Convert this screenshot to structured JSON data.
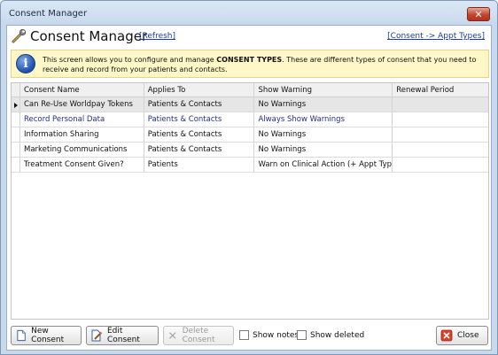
{
  "window": {
    "title": "Consent Manager",
    "close_glyph": "✕"
  },
  "header": {
    "title": "Consent Manager",
    "refresh_link": "[Refresh]",
    "appt_types_link": "[Consent -> Appt Types]",
    "icon": "wrench-icon"
  },
  "info": {
    "icon": "info-icon",
    "icon_glyph": "i",
    "text_before": "This screen allows you to configure and manage ",
    "text_bold": "CONSENT TYPES",
    "text_after": ". These are different types of consent that you need to receive and record from your patients and contacts."
  },
  "grid": {
    "columns": [
      "Consent Name",
      "Applies To",
      "Show Warning",
      "Renewal Period"
    ],
    "rows": [
      {
        "name": "Can Re-Use Worldpay Tokens",
        "applies_to": "Patients & Contacts",
        "show_warning": "No Warnings",
        "renewal": ""
      },
      {
        "name": "Record Personal Data",
        "applies_to": "Patients & Contacts",
        "show_warning": "Always Show Warnings",
        "renewal": ""
      },
      {
        "name": "Information Sharing",
        "applies_to": "Patients & Contacts",
        "show_warning": "No Warnings",
        "renewal": ""
      },
      {
        "name": "Marketing Communications",
        "applies_to": "Patients & Contacts",
        "show_warning": "No Warnings",
        "renewal": ""
      },
      {
        "name": "Treatment Consent Given?",
        "applies_to": "Patients",
        "show_warning": "Warn on Clinical Action (+ Appt Typ...",
        "renewal": ""
      }
    ]
  },
  "footer": {
    "new_consent": "New Consent",
    "edit_consent": "Edit Consent",
    "delete_consent": "Delete Consent",
    "show_notes": "Show notes",
    "show_deleted": "Show deleted",
    "close": "Close"
  },
  "colors": {
    "link": "#1a3e9a",
    "info_bg": "#fff7c8",
    "selected_row": "#e6e6e6",
    "blue_row_text": "#24307e"
  }
}
